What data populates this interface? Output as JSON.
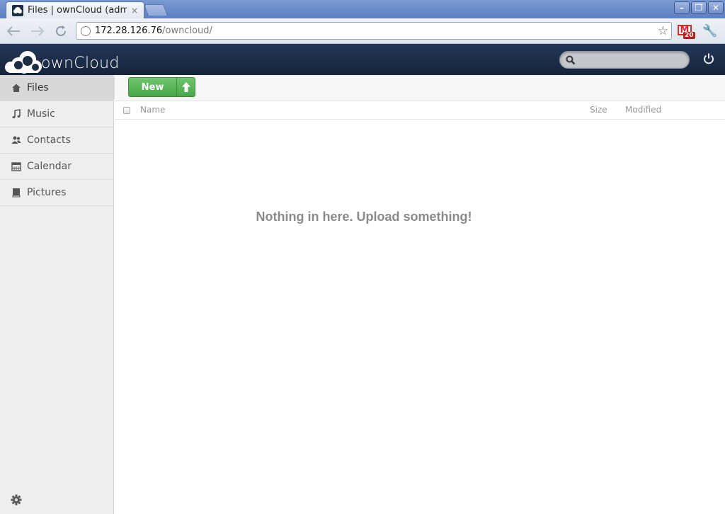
{
  "browser": {
    "tab_title": "Files | ownCloud (admin)",
    "tab_close": "×",
    "url_host": "172.28.126.76",
    "url_path": "/owncloud/",
    "gmail_badge": "20",
    "window_controls": {
      "minimize": "–",
      "restore": "❐",
      "close": "✕"
    }
  },
  "header": {
    "logo_text": "ownCloud",
    "search_placeholder": ""
  },
  "sidebar": {
    "items": [
      {
        "label": "Files",
        "icon": "home-icon",
        "active": true
      },
      {
        "label": "Music",
        "icon": "music-icon",
        "active": false
      },
      {
        "label": "Contacts",
        "icon": "contacts-icon",
        "active": false
      },
      {
        "label": "Calendar",
        "icon": "calendar-icon",
        "active": false
      },
      {
        "label": "Pictures",
        "icon": "pictures-icon",
        "active": false
      }
    ]
  },
  "controls": {
    "new_label": "New"
  },
  "file_list": {
    "columns": {
      "name": "Name",
      "size": "Size",
      "modified": "Modified"
    },
    "rows": []
  },
  "empty_message": "Nothing in here. Upload something!",
  "colors": {
    "header_bg": "#1d2d44",
    "button_green": "#56b454",
    "sidebar_bg": "#eeeeee"
  }
}
